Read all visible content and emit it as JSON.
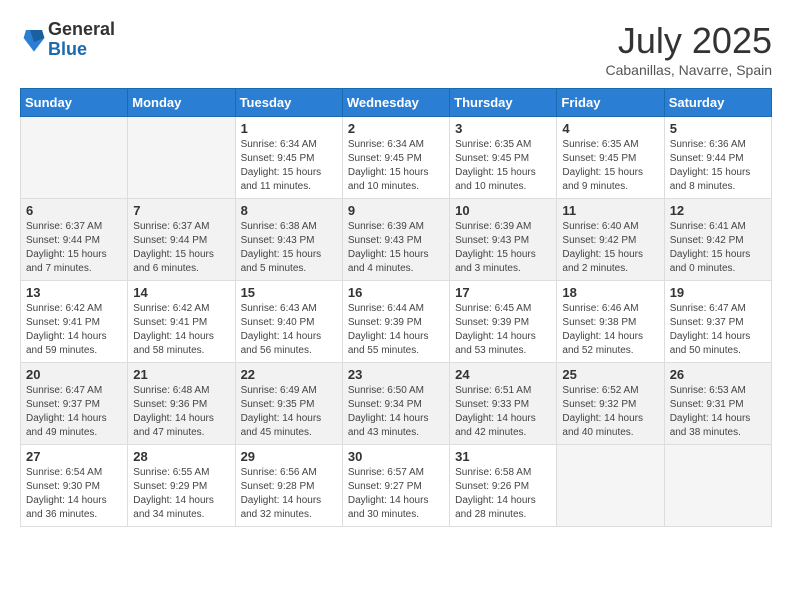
{
  "header": {
    "logo_general": "General",
    "logo_blue": "Blue",
    "month": "July 2025",
    "location": "Cabanillas, Navarre, Spain"
  },
  "weekdays": [
    "Sunday",
    "Monday",
    "Tuesday",
    "Wednesday",
    "Thursday",
    "Friday",
    "Saturday"
  ],
  "weeks": [
    [
      {
        "day": "",
        "content": ""
      },
      {
        "day": "",
        "content": ""
      },
      {
        "day": "1",
        "content": "Sunrise: 6:34 AM\nSunset: 9:45 PM\nDaylight: 15 hours and 11 minutes."
      },
      {
        "day": "2",
        "content": "Sunrise: 6:34 AM\nSunset: 9:45 PM\nDaylight: 15 hours and 10 minutes."
      },
      {
        "day": "3",
        "content": "Sunrise: 6:35 AM\nSunset: 9:45 PM\nDaylight: 15 hours and 10 minutes."
      },
      {
        "day": "4",
        "content": "Sunrise: 6:35 AM\nSunset: 9:45 PM\nDaylight: 15 hours and 9 minutes."
      },
      {
        "day": "5",
        "content": "Sunrise: 6:36 AM\nSunset: 9:44 PM\nDaylight: 15 hours and 8 minutes."
      }
    ],
    [
      {
        "day": "6",
        "content": "Sunrise: 6:37 AM\nSunset: 9:44 PM\nDaylight: 15 hours and 7 minutes."
      },
      {
        "day": "7",
        "content": "Sunrise: 6:37 AM\nSunset: 9:44 PM\nDaylight: 15 hours and 6 minutes."
      },
      {
        "day": "8",
        "content": "Sunrise: 6:38 AM\nSunset: 9:43 PM\nDaylight: 15 hours and 5 minutes."
      },
      {
        "day": "9",
        "content": "Sunrise: 6:39 AM\nSunset: 9:43 PM\nDaylight: 15 hours and 4 minutes."
      },
      {
        "day": "10",
        "content": "Sunrise: 6:39 AM\nSunset: 9:43 PM\nDaylight: 15 hours and 3 minutes."
      },
      {
        "day": "11",
        "content": "Sunrise: 6:40 AM\nSunset: 9:42 PM\nDaylight: 15 hours and 2 minutes."
      },
      {
        "day": "12",
        "content": "Sunrise: 6:41 AM\nSunset: 9:42 PM\nDaylight: 15 hours and 0 minutes."
      }
    ],
    [
      {
        "day": "13",
        "content": "Sunrise: 6:42 AM\nSunset: 9:41 PM\nDaylight: 14 hours and 59 minutes."
      },
      {
        "day": "14",
        "content": "Sunrise: 6:42 AM\nSunset: 9:41 PM\nDaylight: 14 hours and 58 minutes."
      },
      {
        "day": "15",
        "content": "Sunrise: 6:43 AM\nSunset: 9:40 PM\nDaylight: 14 hours and 56 minutes."
      },
      {
        "day": "16",
        "content": "Sunrise: 6:44 AM\nSunset: 9:39 PM\nDaylight: 14 hours and 55 minutes."
      },
      {
        "day": "17",
        "content": "Sunrise: 6:45 AM\nSunset: 9:39 PM\nDaylight: 14 hours and 53 minutes."
      },
      {
        "day": "18",
        "content": "Sunrise: 6:46 AM\nSunset: 9:38 PM\nDaylight: 14 hours and 52 minutes."
      },
      {
        "day": "19",
        "content": "Sunrise: 6:47 AM\nSunset: 9:37 PM\nDaylight: 14 hours and 50 minutes."
      }
    ],
    [
      {
        "day": "20",
        "content": "Sunrise: 6:47 AM\nSunset: 9:37 PM\nDaylight: 14 hours and 49 minutes."
      },
      {
        "day": "21",
        "content": "Sunrise: 6:48 AM\nSunset: 9:36 PM\nDaylight: 14 hours and 47 minutes."
      },
      {
        "day": "22",
        "content": "Sunrise: 6:49 AM\nSunset: 9:35 PM\nDaylight: 14 hours and 45 minutes."
      },
      {
        "day": "23",
        "content": "Sunrise: 6:50 AM\nSunset: 9:34 PM\nDaylight: 14 hours and 43 minutes."
      },
      {
        "day": "24",
        "content": "Sunrise: 6:51 AM\nSunset: 9:33 PM\nDaylight: 14 hours and 42 minutes."
      },
      {
        "day": "25",
        "content": "Sunrise: 6:52 AM\nSunset: 9:32 PM\nDaylight: 14 hours and 40 minutes."
      },
      {
        "day": "26",
        "content": "Sunrise: 6:53 AM\nSunset: 9:31 PM\nDaylight: 14 hours and 38 minutes."
      }
    ],
    [
      {
        "day": "27",
        "content": "Sunrise: 6:54 AM\nSunset: 9:30 PM\nDaylight: 14 hours and 36 minutes."
      },
      {
        "day": "28",
        "content": "Sunrise: 6:55 AM\nSunset: 9:29 PM\nDaylight: 14 hours and 34 minutes."
      },
      {
        "day": "29",
        "content": "Sunrise: 6:56 AM\nSunset: 9:28 PM\nDaylight: 14 hours and 32 minutes."
      },
      {
        "day": "30",
        "content": "Sunrise: 6:57 AM\nSunset: 9:27 PM\nDaylight: 14 hours and 30 minutes."
      },
      {
        "day": "31",
        "content": "Sunrise: 6:58 AM\nSunset: 9:26 PM\nDaylight: 14 hours and 28 minutes."
      },
      {
        "day": "",
        "content": ""
      },
      {
        "day": "",
        "content": ""
      }
    ]
  ]
}
